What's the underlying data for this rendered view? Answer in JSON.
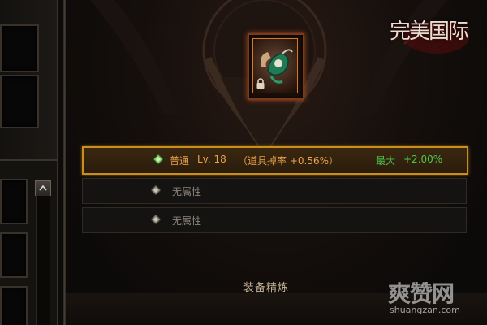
{
  "game_logo": "完美国际",
  "equipment_slot": {
    "icon": "jade-pendant-icon",
    "locked": true
  },
  "refine_rows": [
    {
      "state": "active",
      "grade": "普通",
      "level": "Lv. 18",
      "effect": "（道具掉率 +0.56%）",
      "max_label": "最大",
      "max_value": "+2.00%"
    },
    {
      "state": "empty",
      "label": "无属性"
    },
    {
      "state": "empty",
      "label": "无属性"
    }
  ],
  "panel_title": "装备精炼",
  "watermark": {
    "text": "爽赞网",
    "url": "shuangzan.com"
  },
  "colors": {
    "active_border": "#c88f1c",
    "grade_text": "#e8a24a",
    "max_text": "#4cc84a",
    "empty_text": "#8c867c",
    "title_text": "#c9b698"
  }
}
